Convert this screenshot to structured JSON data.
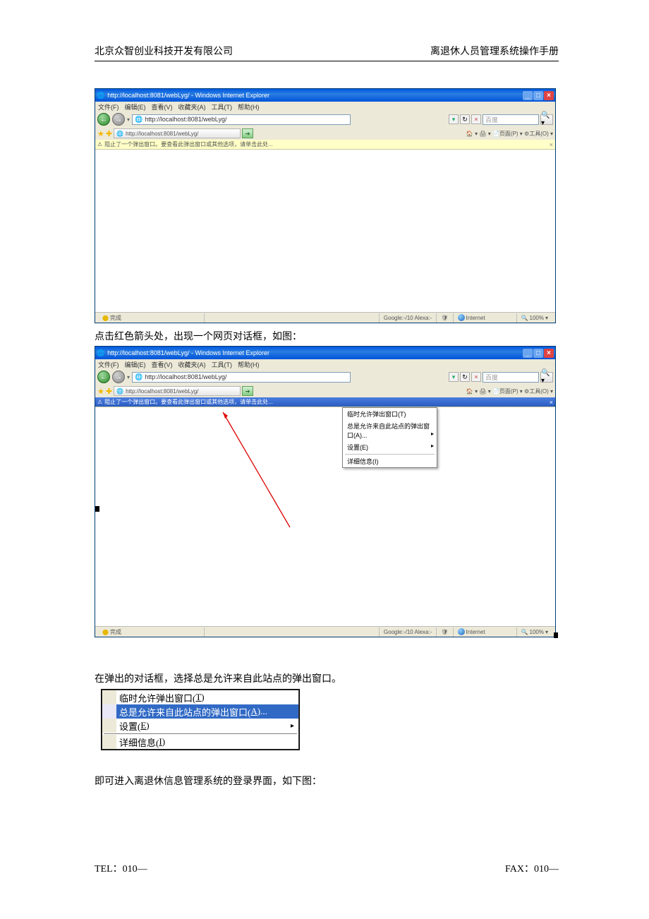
{
  "header": {
    "left": "北京众智创业科技开发有限公司",
    "right": "离退休人员管理系统操作手册"
  },
  "footer": {
    "tel": "TEL：010—",
    "fax": "FAX：010—"
  },
  "ie": {
    "title_prefix": "http://localhost:8081/webLyg/ - Windows Internet Explorer",
    "menu": [
      "文件(F)",
      "编辑(E)",
      "查看(V)",
      "收藏夹(A)",
      "工具(T)",
      "帮助(H)"
    ],
    "url": "http://localhost:8081/webLyg/",
    "search_placeholder": "百度",
    "tab_text": "http://localhost:8081/webLyg/",
    "toolbar_right": "🏠 ▾ 🖨 ▾ 📄页面(P) ▾ ⚙工具(O) ▾",
    "infobar": "阻止了一个弹出窗口。要查看此弹出窗口或其他选项，请单击此处...",
    "status_done": "完成",
    "status_google": "Google:-/10  Alexa:-",
    "status_zone": "Internet",
    "status_zoom": "100%",
    "popup_items": {
      "temp": "临时允许弹出窗口(T)",
      "always": "总是允许来自此站点的弹出窗口(A)...",
      "settings": "设置(E)",
      "details": "详细信息(I)"
    }
  },
  "body_text_1": "点击红色箭头处，出现一个网页对话框，如图：",
  "body_text_2": "在弹出的对话框，选择总是允许来自此站点的弹出窗口。",
  "big_menu": {
    "temp_pre": "临时允许弹出窗口(",
    "temp_key": "T",
    "temp_post": ")",
    "always_pre": "总是允许来自此站点的弹出窗口(",
    "always_key": "A",
    "always_post": ")...",
    "settings_pre": "设置(",
    "settings_key": "E",
    "settings_post": ")",
    "details_pre": "详细信息(",
    "details_key": "I",
    "details_post": ")"
  },
  "body_text_3": "即可进入离退休信息管理系统的登录界面，如下图："
}
